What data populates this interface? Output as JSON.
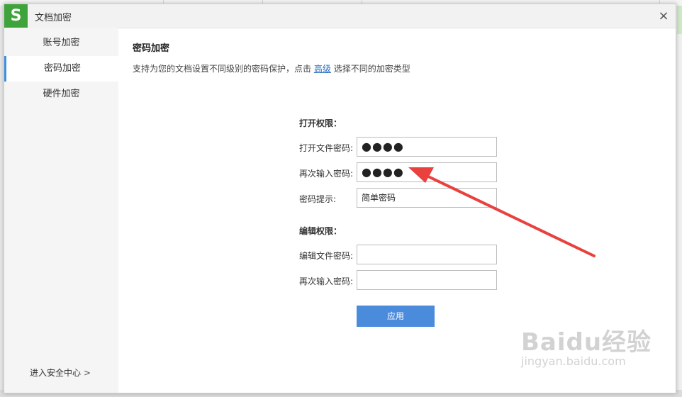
{
  "window": {
    "title": "文档加密",
    "app_icon": "wps-s-logo-icon",
    "close_glyph": "×"
  },
  "colors": {
    "accent": "#4a8bdc",
    "logo_green": "#3ea33a",
    "arrow_red": "#e8413e"
  },
  "sidebar": {
    "items": [
      {
        "label": "账号加密",
        "active": false
      },
      {
        "label": "密码加密",
        "active": true
      },
      {
        "label": "硬件加密",
        "active": false
      }
    ],
    "security_center": {
      "label": "进入安全中心",
      "chevron": ">"
    }
  },
  "main": {
    "title": "密码加密",
    "description_before": "支持为您的文档设置不同级别的密码保护，点击",
    "description_link": "高级",
    "description_after": "选择不同的加密类型",
    "open_section": {
      "label": "打开权限：",
      "password_label": "打开文件密码:",
      "password_value": "●●●●",
      "confirm_label": "再次输入密码:",
      "confirm_value": "●●●●",
      "hint_label": "密码提示:",
      "hint_value": "简单密码"
    },
    "edit_section": {
      "label": "编辑权限：",
      "password_label": "编辑文件密码:",
      "password_value": "",
      "confirm_label": "再次输入密码:",
      "confirm_value": ""
    },
    "apply_label": "应用"
  },
  "watermark": {
    "text": "Baidu经验",
    "url_text": "jingyan.baidu.com"
  }
}
